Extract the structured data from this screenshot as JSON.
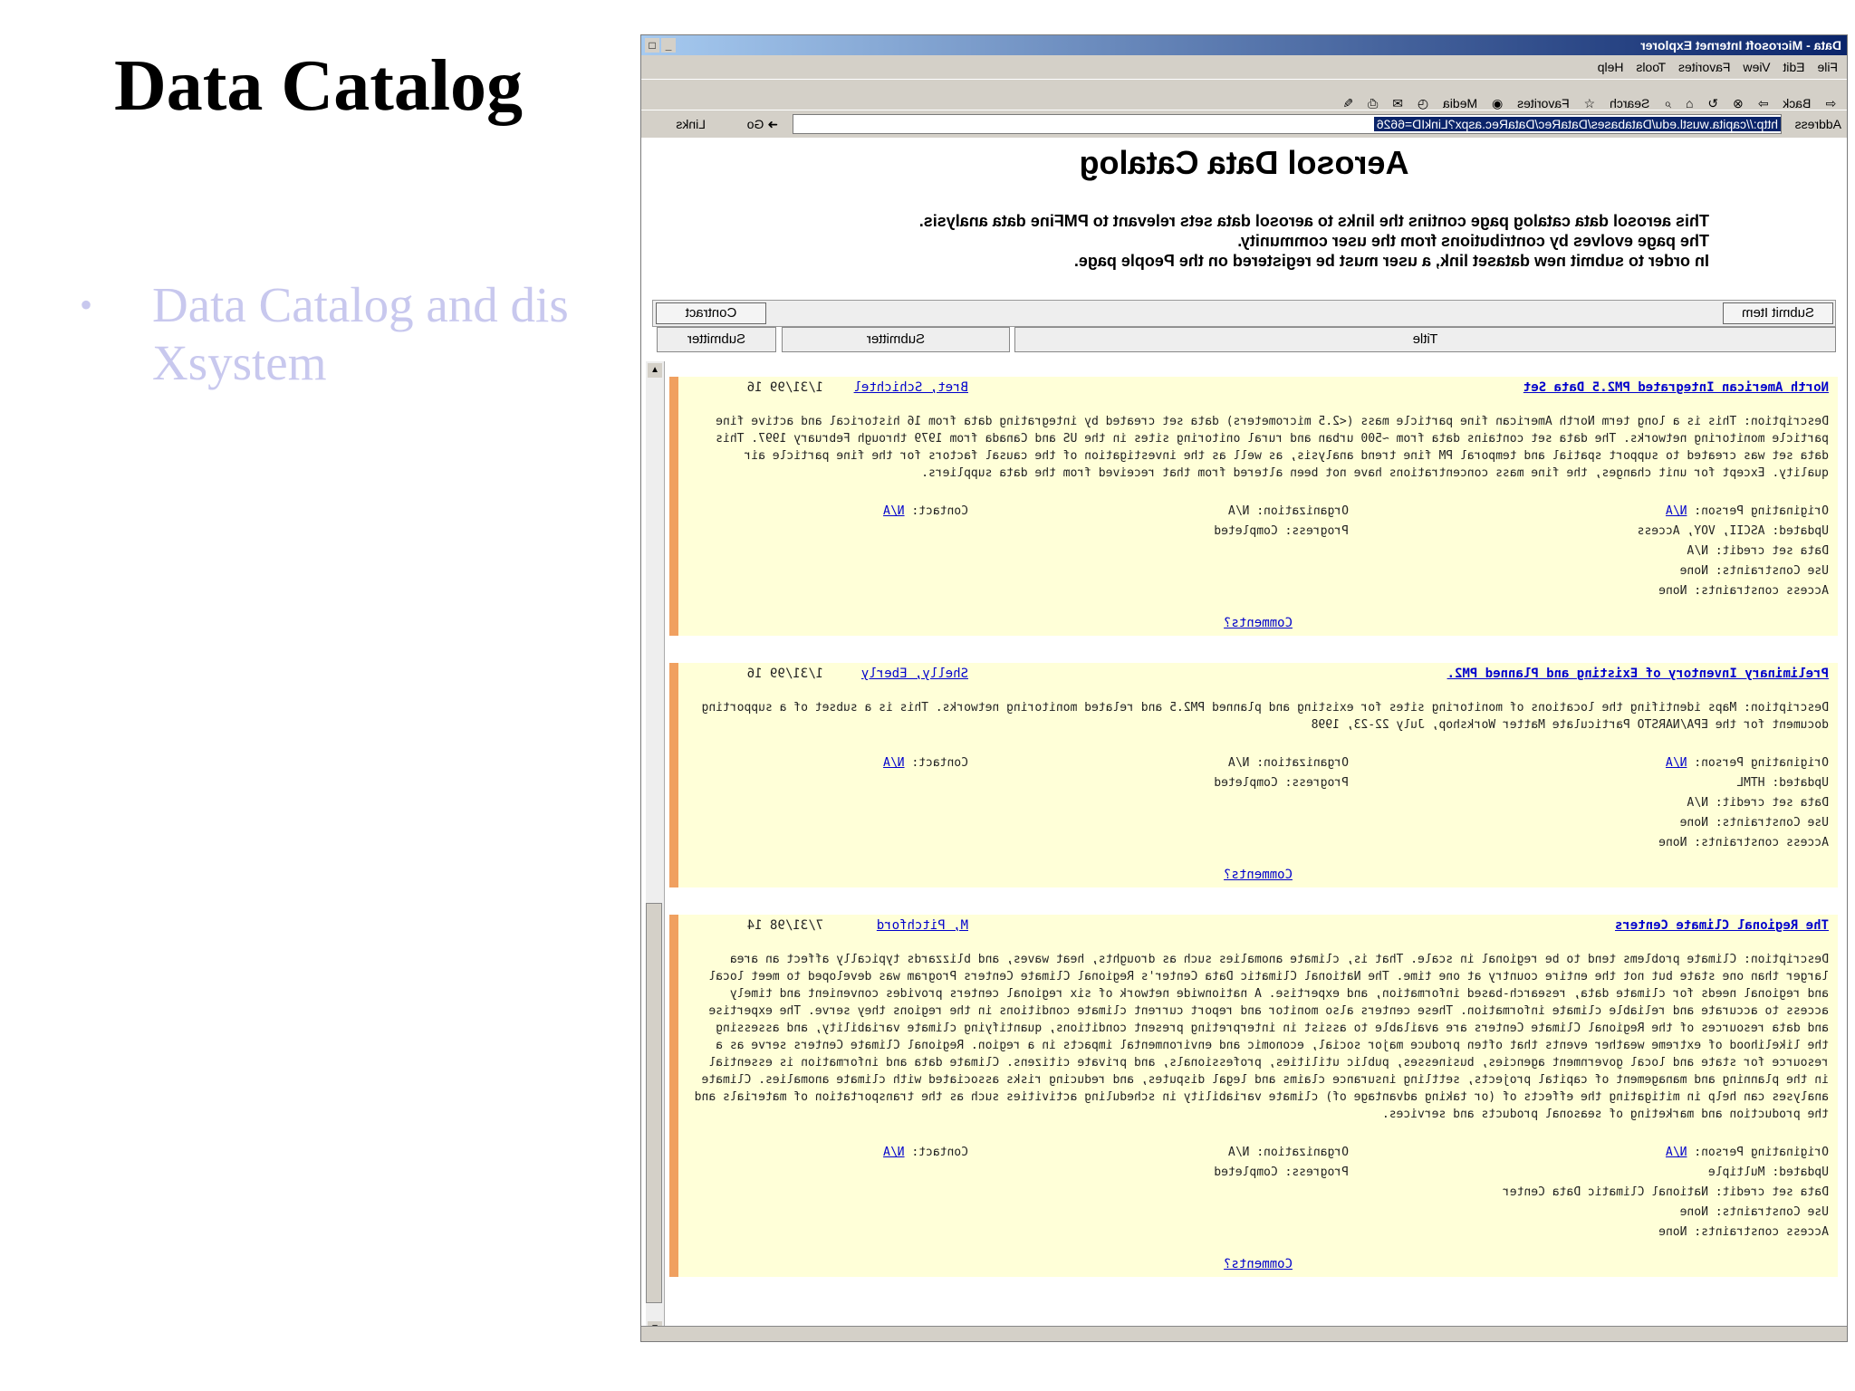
{
  "slide": {
    "title": "Data Catalog",
    "bullet": "•",
    "bullet_text_1": "Data Catalog and dis",
    "bullet_text_2": "Xsystem"
  },
  "browser": {
    "window_title": "Data - Microsoft Internet Explorer",
    "menu": [
      "File",
      "Edit",
      "View",
      "Favorites",
      "Tools",
      "Help"
    ],
    "toolbar": [
      "Back",
      "Search",
      "Favorites",
      "Media"
    ],
    "address_label": "Address",
    "address_url": "http://capita.wustl.edu/Databases/DataRec/DataRec.aspx?LinkID=6626",
    "go_label": "Go",
    "links_label": "Links"
  },
  "page": {
    "heading": "Aerosol Data Catalog",
    "intro": [
      "This aerosol data catalog page contins the links to aerosol data sets relevant to PMFine data analysis.",
      "The page evolves by contributions from the user community.",
      "In order to submit new dataset link, a user must be registered on the People page."
    ],
    "buttons": {
      "submit_item": "Submit Item",
      "contact": "Contract"
    },
    "columns": {
      "title": "Title",
      "submitter": "Submitter",
      "submitter2": "Submitter"
    }
  },
  "records": [
    {
      "title": "North American Integrated PM2.5 Data Set",
      "submitter": "Bret, Schichtel",
      "date": "1/31/99 16",
      "description": "Description: This is a long term North American fine particle mass (<2.5 micrometers) data set created by integrating data from 16 historical and active fine particle monitoring networks. The data set contains data from ~500 urban and rural onitoring sites in the US and Canada from 1979 through February 1997. This data set was created to support spatial and temporal PM fine trend analysis, as well as the investigation of the causal factors for the fine particle air quality. Except for unit changes, the fine mass concentrations have not been altered from that received from the data suppliers.",
      "originating_person_label": "Originating Person:",
      "originating_person": "N/A",
      "updated": "Updated: ASCII, VOY, Access",
      "credit": "Data set credit: N/A",
      "use_constraints": "Use Constraints: None",
      "access_constraints": "Access constraints: None",
      "organization": "Organization: N/A",
      "progress": "Progress: Completed",
      "contact_label": "Contact:",
      "contact": "N/A",
      "comments": "Comments?"
    },
    {
      "title": "Preliminary Inventory of Existing and Planned PM2.",
      "submitter": "Shelly, Eberly",
      "date": "1/31/99 16",
      "description": "Description: Maps identifing the locations of monitoring sites for existing and planned PM2.5 and related monitoring networks. This is a subset of a supporting document for the EPA/NARSTO Particulate Matter Workshop, July 22-23, 1998",
      "originating_person_label": "Originating Person:",
      "originating_person": "N/A",
      "updated": "Updated: HTML",
      "credit": "Data set credit: N/A",
      "use_constraints": "Use Constraints: None",
      "access_constraints": "Access constraints: None",
      "organization": "Organization: N/A",
      "progress": "Progress: Completed",
      "contact_label": "Contact:",
      "contact": "N/A",
      "comments": "Comments?"
    },
    {
      "title": "The Regional Climate Centers",
      "submitter": "M, Pitchford",
      "date": "7/31/98 14",
      "description": "Description: Climate problems tend to be regional in scale. That is, climate anomalies such as droughts, heat waves, and blizzards typically affect an area larger than one state but not the entire country at one time. The National Climatic Data Center's Regional Climate Centers Program was developed to meet local and regional needs for climate data, research-based information, and expertise. A nationwide network of six regional centers provides convenient and timely access to accurate and reliable climate information. These centers also monitor and report current climate conditions in the regions they serve. The expertise and data resources of the Regional Climate Centers are available to assist in interpreting present conditions, quantifying climate variability, and assessing the likelihood of extreme weather events that often produce major social, economic and environmental impacts in a region. Regional Climate Centers serve as a resource for state and local government agencies, businesses, public utilities, professionals, and private citizens. Climate data and information is essential in the planning and management of capital projects, settling insurance claims and legal disputes, and reducing risks associated with climate anomalies. Climate analyses can help in mitigating the effects of (or taking advantage of) climate variability in scheduling activities such as the transportation of materials and the production and marketing of seasonal products and services.",
      "originating_person_label": "Originating Person:",
      "originating_person": "N/A",
      "updated": "Updated: Multiple",
      "credit": "Data set credit: National Climatic Data Center",
      "use_constraints": "Use Constraints: None",
      "access_constraints": "Access constraints: None",
      "organization": "Organization: N/A",
      "progress": "Progress: Completed",
      "contact_label": "Contact:",
      "contact": "N/A",
      "comments": "Comments?"
    }
  ]
}
